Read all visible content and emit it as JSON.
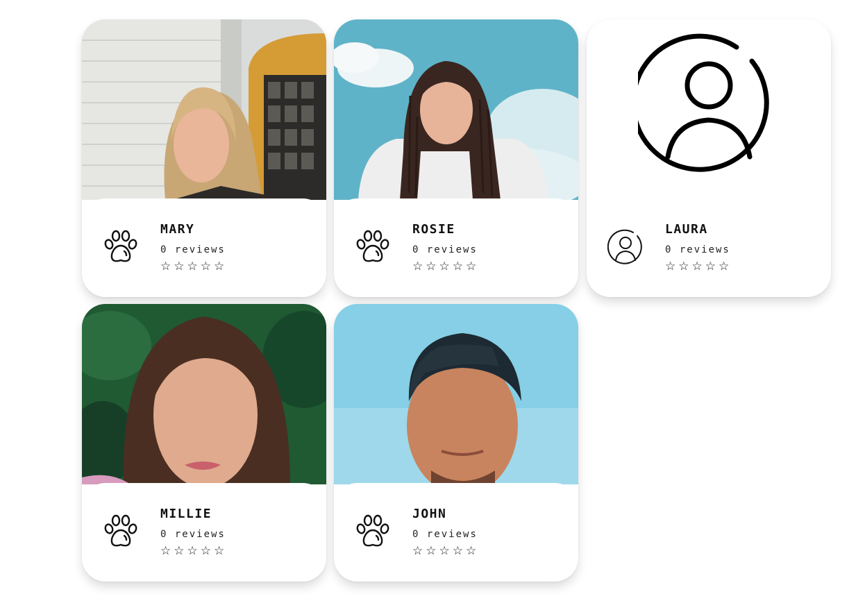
{
  "profiles": [
    {
      "name": "MARY",
      "reviews": "0 reviews",
      "stars": "☆☆☆☆☆",
      "photo": "woman-blonde-portrait",
      "icon": "paw-icon"
    },
    {
      "name": "ROSIE",
      "reviews": "0 reviews",
      "stars": "☆☆☆☆☆",
      "photo": "woman-braids-sky",
      "icon": "paw-icon"
    },
    {
      "name": "LAURA",
      "reviews": "0 reviews",
      "stars": "☆☆☆☆☆",
      "photo": "placeholder-user-icon",
      "icon": "user-circle-icon"
    },
    {
      "name": "MILLIE",
      "reviews": "0 reviews",
      "stars": "☆☆☆☆☆",
      "photo": "woman-brunette-greenery",
      "icon": "paw-icon"
    },
    {
      "name": "JOHN",
      "reviews": "0 reviews",
      "stars": "☆☆☆☆☆",
      "photo": "man-cap-sky",
      "icon": "paw-icon"
    }
  ]
}
